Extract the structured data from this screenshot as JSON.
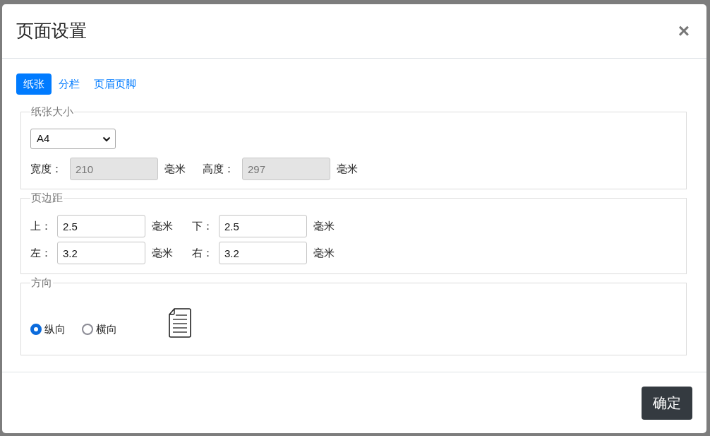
{
  "dialog": {
    "title": "页面设置",
    "close": "×"
  },
  "tabs": [
    {
      "label": "纸张",
      "selected": true
    },
    {
      "label": "分栏",
      "selected": false
    },
    {
      "label": "页眉页脚",
      "selected": false
    }
  ],
  "paper_size": {
    "legend": "纸张大小",
    "select": {
      "value": "A4"
    },
    "fields": [
      {
        "label": "宽度：",
        "value": "210",
        "unit": "毫米",
        "disabled": true
      },
      {
        "label": "高度：",
        "value": "297",
        "unit": "毫米",
        "disabled": true
      }
    ]
  },
  "margins": {
    "legend": "页边距",
    "fields": [
      {
        "label": "上：",
        "value": "2.5",
        "unit": "毫米",
        "disabled": false
      },
      {
        "label": "下：",
        "value": "2.5",
        "unit": "毫米",
        "disabled": false
      },
      {
        "label": "左：",
        "value": "3.2",
        "unit": "毫米",
        "disabled": false
      },
      {
        "label": "右：",
        "value": "3.2",
        "unit": "毫米",
        "disabled": false
      }
    ]
  },
  "orientation": {
    "legend": "方向",
    "options": [
      {
        "label": "纵向",
        "selected": true
      },
      {
        "label": "横向",
        "selected": false
      }
    ]
  },
  "footer": {
    "confirm": "确定"
  }
}
